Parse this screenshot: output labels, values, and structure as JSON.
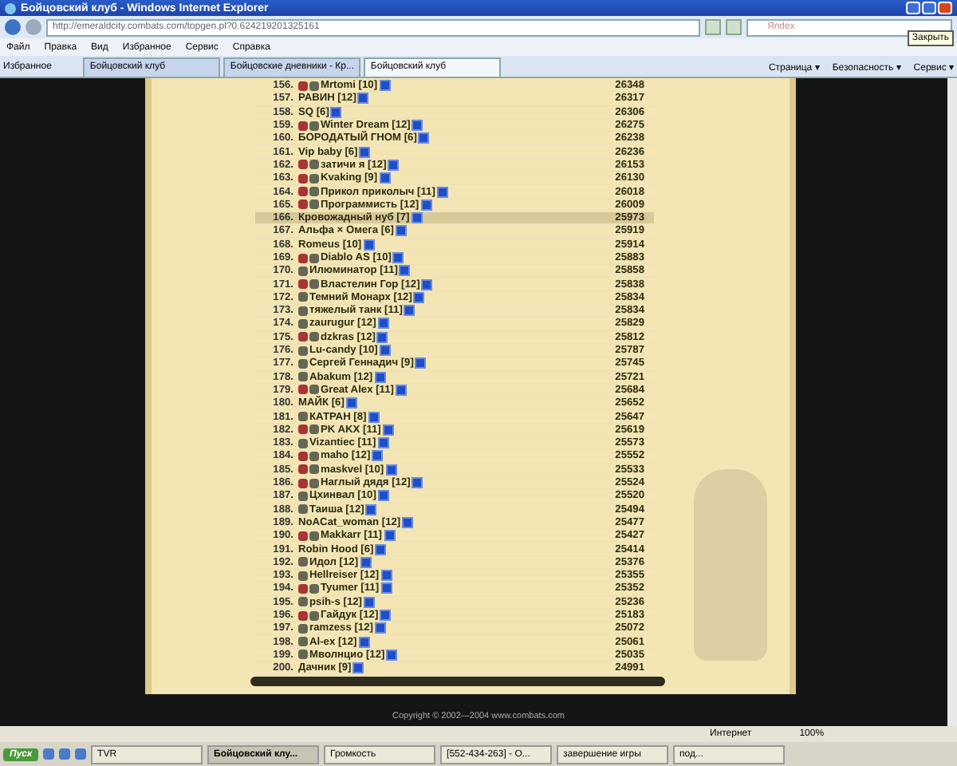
{
  "window": {
    "title": "Бойцовский клуб - Windows Internet Explorer"
  },
  "address_bar": {
    "url": "http://emeraldcity.combats.com/topgen.pl?0.624219201325161"
  },
  "search": {
    "placeholder": "Яndex"
  },
  "tooltip": "Закрыть",
  "menu": [
    "Файл",
    "Правка",
    "Вид",
    "Избранное",
    "Сервис",
    "Справка"
  ],
  "favorites": "Избранное",
  "tabs": [
    {
      "label": "Бойцовский клуб",
      "selected": false
    },
    {
      "label": "Бойцовские дневники - Кр...",
      "selected": false
    },
    {
      "label": "Бойцовский клуб",
      "selected": true
    }
  ],
  "commands": [
    "Страница ▾",
    "Безопасность ▾",
    "Сервис ▾"
  ],
  "rows": [
    {
      "rank": "156.",
      "name": "Mrtomi [10]",
      "score": "26348",
      "align": true,
      "clan": true,
      "selected": false
    },
    {
      "rank": "157.",
      "name": "РАВИН [12]",
      "score": "26317",
      "align": false,
      "clan": false,
      "selected": false
    },
    {
      "rank": "158.",
      "name": "SQ [6]",
      "score": "26306",
      "align": false,
      "clan": false,
      "selected": false
    },
    {
      "rank": "159.",
      "name": "Winter Dream [12]",
      "score": "26275",
      "align": true,
      "clan": true,
      "selected": false
    },
    {
      "rank": "160.",
      "name": "БОРОДАТЫЙ ГНОМ [6]",
      "score": "26238",
      "align": false,
      "clan": false,
      "selected": false
    },
    {
      "rank": "161.",
      "name": "Vip baby [6]",
      "score": "26236",
      "align": false,
      "clan": false,
      "selected": false
    },
    {
      "rank": "162.",
      "name": "затичи я [12]",
      "score": "26153",
      "align": true,
      "clan": true,
      "selected": false
    },
    {
      "rank": "163.",
      "name": "Kvaking [9]",
      "score": "26130",
      "align": true,
      "clan": true,
      "selected": false
    },
    {
      "rank": "164.",
      "name": "Прикол приколыч [11]",
      "score": "26018",
      "align": true,
      "clan": true,
      "selected": false
    },
    {
      "rank": "165.",
      "name": "Программисть [12]",
      "score": "26009",
      "align": true,
      "clan": true,
      "selected": false
    },
    {
      "rank": "166.",
      "name": "Кровожадный нуб [7]",
      "score": "25973",
      "align": false,
      "clan": false,
      "selected": true
    },
    {
      "rank": "167.",
      "name": "Альфа × Омега [6]",
      "score": "25919",
      "align": false,
      "clan": false,
      "selected": false
    },
    {
      "rank": "168.",
      "name": "Romeus [10]",
      "score": "25914",
      "align": false,
      "clan": false,
      "selected": false
    },
    {
      "rank": "169.",
      "name": "Diablo AS [10]",
      "score": "25883",
      "align": true,
      "clan": true,
      "selected": false
    },
    {
      "rank": "170.",
      "name": "Илюминатор [11]",
      "score": "25858",
      "align": false,
      "clan": true,
      "selected": false
    },
    {
      "rank": "171.",
      "name": "Властелин Гор [12]",
      "score": "25838",
      "align": true,
      "clan": true,
      "selected": false
    },
    {
      "rank": "172.",
      "name": "Темний Монарх [12]",
      "score": "25834",
      "align": false,
      "clan": true,
      "selected": false
    },
    {
      "rank": "173.",
      "name": "тяжелый танк [11]",
      "score": "25834",
      "align": false,
      "clan": true,
      "selected": false
    },
    {
      "rank": "174.",
      "name": "zaurugur [12]",
      "score": "25829",
      "align": false,
      "clan": true,
      "selected": false
    },
    {
      "rank": "175.",
      "name": "dzkras [12]",
      "score": "25812",
      "align": true,
      "clan": true,
      "selected": false
    },
    {
      "rank": "176.",
      "name": "Lu-candy [10]",
      "score": "25787",
      "align": false,
      "clan": true,
      "selected": false
    },
    {
      "rank": "177.",
      "name": "Сергей Геннадич [9]",
      "score": "25745",
      "align": false,
      "clan": true,
      "selected": false
    },
    {
      "rank": "178.",
      "name": "Abakum [12]",
      "score": "25721",
      "align": false,
      "clan": true,
      "selected": false
    },
    {
      "rank": "179.",
      "name": "Great Alex [11]",
      "score": "25684",
      "align": true,
      "clan": true,
      "selected": false
    },
    {
      "rank": "180.",
      "name": "МАЙК [6]",
      "score": "25652",
      "align": false,
      "clan": false,
      "selected": false
    },
    {
      "rank": "181.",
      "name": "КАТРАН [8]",
      "score": "25647",
      "align": false,
      "clan": true,
      "selected": false
    },
    {
      "rank": "182.",
      "name": "PK AKX [11]",
      "score": "25619",
      "align": true,
      "clan": true,
      "selected": false
    },
    {
      "rank": "183.",
      "name": "Vizantiec [11]",
      "score": "25573",
      "align": false,
      "clan": true,
      "selected": false
    },
    {
      "rank": "184.",
      "name": "maho [12]",
      "score": "25552",
      "align": true,
      "clan": true,
      "selected": false
    },
    {
      "rank": "185.",
      "name": "maskvel [10]",
      "score": "25533",
      "align": true,
      "clan": true,
      "selected": false
    },
    {
      "rank": "186.",
      "name": "Наглый дядя [12]",
      "score": "25524",
      "align": true,
      "clan": true,
      "selected": false
    },
    {
      "rank": "187.",
      "name": "Цхинвал [10]",
      "score": "25520",
      "align": false,
      "clan": true,
      "selected": false
    },
    {
      "rank": "188.",
      "name": "Таиша [12]",
      "score": "25494",
      "align": false,
      "clan": true,
      "selected": false
    },
    {
      "rank": "189.",
      "name": "NoACat_woman [12]",
      "score": "25477",
      "align": false,
      "clan": false,
      "selected": false
    },
    {
      "rank": "190.",
      "name": "Makkarr [11]",
      "score": "25427",
      "align": true,
      "clan": true,
      "selected": false
    },
    {
      "rank": "191.",
      "name": "Robin Hood [6]",
      "score": "25414",
      "align": false,
      "clan": false,
      "selected": false
    },
    {
      "rank": "192.",
      "name": "Идол [12]",
      "score": "25376",
      "align": false,
      "clan": true,
      "selected": false
    },
    {
      "rank": "193.",
      "name": "Hellreiser [12]",
      "score": "25355",
      "align": false,
      "clan": true,
      "selected": false
    },
    {
      "rank": "194.",
      "name": "Tyumer [11]",
      "score": "25352",
      "align": true,
      "clan": true,
      "selected": false
    },
    {
      "rank": "195.",
      "name": "psih-s [12]",
      "score": "25236",
      "align": false,
      "clan": true,
      "selected": false
    },
    {
      "rank": "196.",
      "name": "Гайдук [12]",
      "score": "25183",
      "align": true,
      "clan": true,
      "selected": false
    },
    {
      "rank": "197.",
      "name": "ramzess [12]",
      "score": "25072",
      "align": false,
      "clan": true,
      "selected": false
    },
    {
      "rank": "198.",
      "name": "Al-ex [12]",
      "score": "25061",
      "align": false,
      "clan": true,
      "selected": false
    },
    {
      "rank": "199.",
      "name": "Мволнцио [12]",
      "score": "25035",
      "align": false,
      "clan": true,
      "selected": false
    },
    {
      "rank": "200.",
      "name": "Дачник [9]",
      "score": "24991",
      "align": false,
      "clan": false,
      "selected": false
    }
  ],
  "copyright": "Copyright © 2002—2004 www.combats.com",
  "status_bar": {
    "zone": "Интернет",
    "zoom": "100%"
  },
  "taskbar": {
    "start": "Пуск",
    "buttons": [
      {
        "label": "TVR",
        "selected": false
      },
      {
        "label": "Бойцовский клу...",
        "selected": true
      },
      {
        "label": "Громкость",
        "selected": false
      },
      {
        "label": "[552-434-263] - О...",
        "selected": false
      },
      {
        "label": "завершение игры",
        "selected": false
      },
      {
        "label": "под...",
        "selected": false
      }
    ]
  }
}
